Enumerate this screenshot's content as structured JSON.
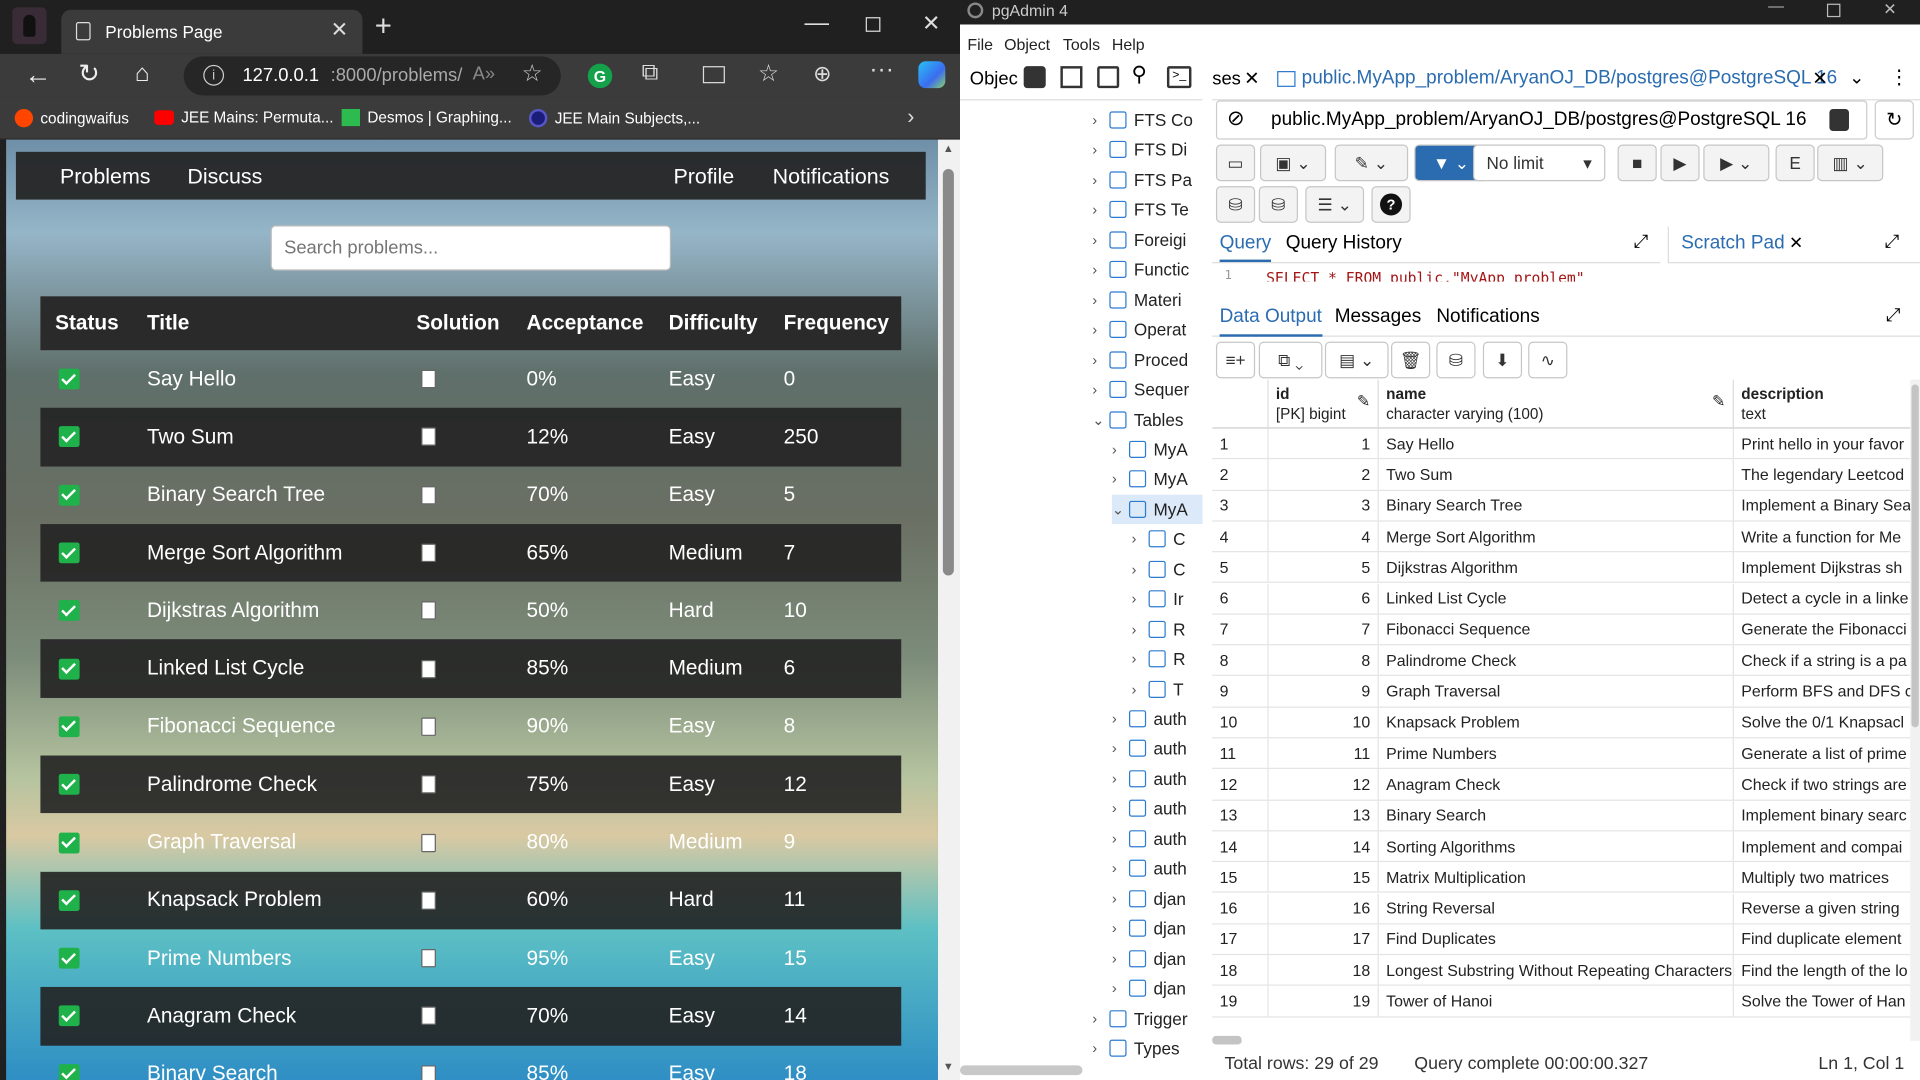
{
  "browser": {
    "tab_title": "Problems Page",
    "url_host": "127.0.0.1",
    "url_rest": ":8000/problems/",
    "favorites": [
      "codingwaifus",
      "JEE Mains: Permuta...",
      "Desmos | Graphing...",
      "JEE Main Subjects,..."
    ]
  },
  "site": {
    "nav": {
      "problems": "Problems",
      "discuss": "Discuss",
      "profile": "Profile",
      "notifications": "Notifications"
    },
    "search_placeholder": "Search problems...",
    "columns": [
      "Status",
      "Title",
      "Solution",
      "Acceptance",
      "Difficulty",
      "Frequency"
    ],
    "rows": [
      {
        "title": "Say Hello",
        "acceptance": "0%",
        "difficulty": "Easy",
        "frequency": "0"
      },
      {
        "title": "Two Sum",
        "acceptance": "12%",
        "difficulty": "Easy",
        "frequency": "250"
      },
      {
        "title": "Binary Search Tree",
        "acceptance": "70%",
        "difficulty": "Easy",
        "frequency": "5"
      },
      {
        "title": "Merge Sort Algorithm",
        "acceptance": "65%",
        "difficulty": "Medium",
        "frequency": "7"
      },
      {
        "title": "Dijkstras Algorithm",
        "acceptance": "50%",
        "difficulty": "Hard",
        "frequency": "10"
      },
      {
        "title": "Linked List Cycle",
        "acceptance": "85%",
        "difficulty": "Medium",
        "frequency": "6"
      },
      {
        "title": "Fibonacci Sequence",
        "acceptance": "90%",
        "difficulty": "Easy",
        "frequency": "8"
      },
      {
        "title": "Palindrome Check",
        "acceptance": "75%",
        "difficulty": "Easy",
        "frequency": "12"
      },
      {
        "title": "Graph Traversal",
        "acceptance": "80%",
        "difficulty": "Medium",
        "frequency": "9"
      },
      {
        "title": "Knapsack Problem",
        "acceptance": "60%",
        "difficulty": "Hard",
        "frequency": "11"
      },
      {
        "title": "Prime Numbers",
        "acceptance": "95%",
        "difficulty": "Easy",
        "frequency": "15"
      },
      {
        "title": "Anagram Check",
        "acceptance": "70%",
        "difficulty": "Easy",
        "frequency": "14"
      },
      {
        "title": "Binary Search",
        "acceptance": "85%",
        "difficulty": "Easy",
        "frequency": "18"
      }
    ]
  },
  "pgadmin": {
    "app_title": "pgAdmin 4",
    "menu": [
      "File",
      "Object",
      "Tools",
      "Help"
    ],
    "object_label": "Objec",
    "tab_prev": "ses",
    "tab_active": "public.MyApp_problem/AryanOJ_DB/postgres@PostgreSQL 16",
    "connection": "public.MyApp_problem/AryanOJ_DB/postgres@PostgreSQL 16",
    "limit": "No limit",
    "query_tabs": [
      "Query",
      "Query History"
    ],
    "scratch_pad": "Scratch Pad",
    "sql_line_no": "1",
    "sql": "SELECT * FROM public.\"MyApp_problem\"",
    "output_tabs": [
      "Data Output",
      "Messages",
      "Notifications"
    ],
    "tree": [
      {
        "label": "FTS Co",
        "level": 0,
        "open": false
      },
      {
        "label": "FTS Di",
        "level": 0,
        "open": false
      },
      {
        "label": "FTS Pa",
        "level": 0,
        "open": false
      },
      {
        "label": "FTS Te",
        "level": 0,
        "open": false
      },
      {
        "label": "Foreigi",
        "level": 0,
        "open": false
      },
      {
        "label": "Functic",
        "level": 0,
        "open": false
      },
      {
        "label": "Materi",
        "level": 0,
        "open": false
      },
      {
        "label": "Operat",
        "level": 0,
        "open": false
      },
      {
        "label": "Proced",
        "level": 0,
        "open": false
      },
      {
        "label": "Sequer",
        "level": 0,
        "open": false
      },
      {
        "label": "Tables",
        "level": 0,
        "open": true
      },
      {
        "label": "MyA",
        "level": 1,
        "open": false
      },
      {
        "label": "MyA",
        "level": 1,
        "open": false
      },
      {
        "label": "MyA",
        "level": 1,
        "open": true,
        "selected": true
      },
      {
        "label": "C",
        "level": 2,
        "open": false
      },
      {
        "label": "C",
        "level": 2,
        "open": false
      },
      {
        "label": "Ir",
        "level": 2,
        "open": false
      },
      {
        "label": "R",
        "level": 2,
        "open": false
      },
      {
        "label": "R",
        "level": 2,
        "open": false
      },
      {
        "label": "T",
        "level": 2,
        "open": false
      },
      {
        "label": "auth",
        "level": 1,
        "open": false
      },
      {
        "label": "auth",
        "level": 1,
        "open": false
      },
      {
        "label": "auth",
        "level": 1,
        "open": false
      },
      {
        "label": "auth",
        "level": 1,
        "open": false
      },
      {
        "label": "auth",
        "level": 1,
        "open": false
      },
      {
        "label": "auth",
        "level": 1,
        "open": false
      },
      {
        "label": "djan",
        "level": 1,
        "open": false
      },
      {
        "label": "djan",
        "level": 1,
        "open": false
      },
      {
        "label": "djan",
        "level": 1,
        "open": false
      },
      {
        "label": "djan",
        "level": 1,
        "open": false
      },
      {
        "label": "Trigger",
        "level": 0,
        "open": false
      },
      {
        "label": "Types",
        "level": 0,
        "open": false
      }
    ],
    "grid": {
      "columns": [
        {
          "name": "id",
          "type": "[PK] bigint"
        },
        {
          "name": "name",
          "type": "character varying (100)"
        },
        {
          "name": "description",
          "type": "text"
        }
      ],
      "rows": [
        [
          "1",
          "1",
          "Say Hello",
          "Print hello in your favor"
        ],
        [
          "2",
          "2",
          "Two Sum",
          "The legendary Leetcod"
        ],
        [
          "3",
          "3",
          "Binary Search Tree",
          "Implement a Binary Sea"
        ],
        [
          "4",
          "4",
          "Merge Sort Algorithm",
          "Write a function for Me"
        ],
        [
          "5",
          "5",
          "Dijkstras Algorithm",
          "Implement Dijkstras sh"
        ],
        [
          "6",
          "6",
          "Linked List Cycle",
          "Detect a cycle in a linke"
        ],
        [
          "7",
          "7",
          "Fibonacci Sequence",
          "Generate the Fibonacci"
        ],
        [
          "8",
          "8",
          "Palindrome Check",
          "Check if a string is a pa"
        ],
        [
          "9",
          "9",
          "Graph Traversal",
          "Perform BFS and DFS c"
        ],
        [
          "10",
          "10",
          "Knapsack Problem",
          "Solve the 0/1 Knapsacl"
        ],
        [
          "11",
          "11",
          "Prime Numbers",
          "Generate a list of prime"
        ],
        [
          "12",
          "12",
          "Anagram Check",
          "Check if two strings are"
        ],
        [
          "13",
          "13",
          "Binary Search",
          "Implement binary searc"
        ],
        [
          "14",
          "14",
          "Sorting Algorithms",
          "Implement and compai"
        ],
        [
          "15",
          "15",
          "Matrix Multiplication",
          "Multiply two matrices"
        ],
        [
          "16",
          "16",
          "String Reversal",
          "Reverse a given string"
        ],
        [
          "17",
          "17",
          "Find Duplicates",
          "Find duplicate element"
        ],
        [
          "18",
          "18",
          "Longest Substring Without Repeating Characters",
          "Find the length of the lo"
        ],
        [
          "19",
          "19",
          "Tower of Hanoi",
          "Solve the Tower of Han"
        ]
      ]
    },
    "status": {
      "rows": "Total rows: 29 of 29",
      "time": "Query complete 00:00:00.327",
      "pos": "Ln 1, Col 1"
    }
  }
}
